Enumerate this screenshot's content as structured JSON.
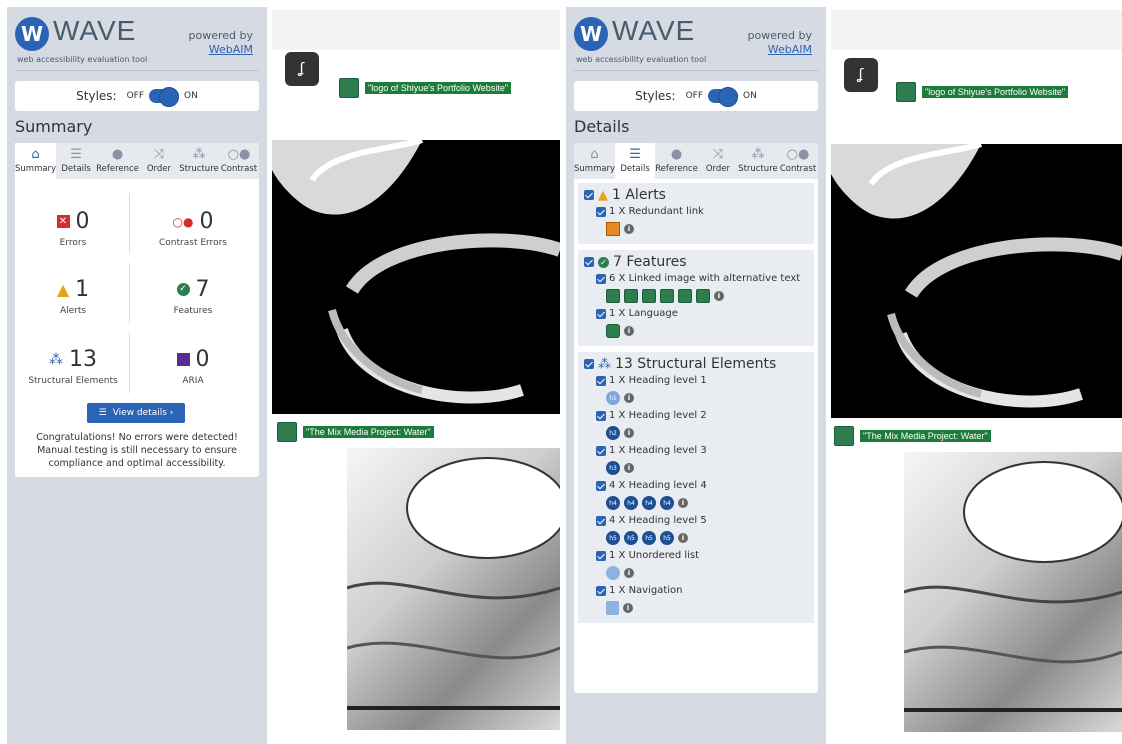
{
  "wave": {
    "logo_letter": "W",
    "title": "WAVE",
    "subtitle": "web accessibility evaluation tool",
    "powered_by": "powered by",
    "webaim_link": "WebAIM",
    "styles_label": "Styles:",
    "styles_off": "OFF",
    "styles_on": "ON"
  },
  "tabs": [
    {
      "label": "Summary",
      "icon": "home-icon"
    },
    {
      "label": "Details",
      "icon": "list-icon"
    },
    {
      "label": "Reference",
      "icon": "info-icon"
    },
    {
      "label": "Order",
      "icon": "order-icon"
    },
    {
      "label": "Structure",
      "icon": "structure-icon"
    },
    {
      "label": "Contrast",
      "icon": "contrast-icon"
    }
  ],
  "summary": {
    "panel_title": "Summary",
    "errors": {
      "count": "0",
      "label": "Errors"
    },
    "contrast_errors": {
      "count": "0",
      "label": "Contrast Errors"
    },
    "alerts": {
      "count": "1",
      "label": "Alerts"
    },
    "features": {
      "count": "7",
      "label": "Features"
    },
    "structural": {
      "count": "13",
      "label": "Structural Elements"
    },
    "aria": {
      "count": "0",
      "label": "ARIA"
    },
    "view_details": "View details ›",
    "congrats": "Congratulations! No errors were detected! Manual testing is still necessary to ensure compliance and optimal accessibility."
  },
  "details": {
    "panel_title": "Details",
    "alerts_title": "1 Alerts",
    "redundant_link": "1 X Redundant link",
    "features_title": "7 Features",
    "linked_image": "6 X Linked image with alternative text",
    "language": "1 X Language",
    "structural_title": "13 Structural Elements",
    "h1": "1 X Heading level 1",
    "h2": "1 X Heading level 2",
    "h3": "1 X Heading level 3",
    "h4": "4 X Heading level 4",
    "h5": "4 X Heading level 5",
    "ul": "1 X Unordered list",
    "nav": "1 X Navigation",
    "h1_icon": "h1",
    "h2_icon": "h2",
    "h3_icon": "h3",
    "h4_icon": "h4",
    "h5_icon": "h5"
  },
  "site": {
    "logo_alt": "\"logo of Shiyue's Portfolio Website\"",
    "project_alt": "\"The Mix Media Project: Water\""
  },
  "colors": {
    "wave_blue": "#2b64b4",
    "sidebar_bg": "#d5dae3",
    "feature_green": "#2e7d4f",
    "error_red": "#d62d2d",
    "alert_orange": "#e8a21a",
    "aria_purple": "#5c2d91"
  }
}
